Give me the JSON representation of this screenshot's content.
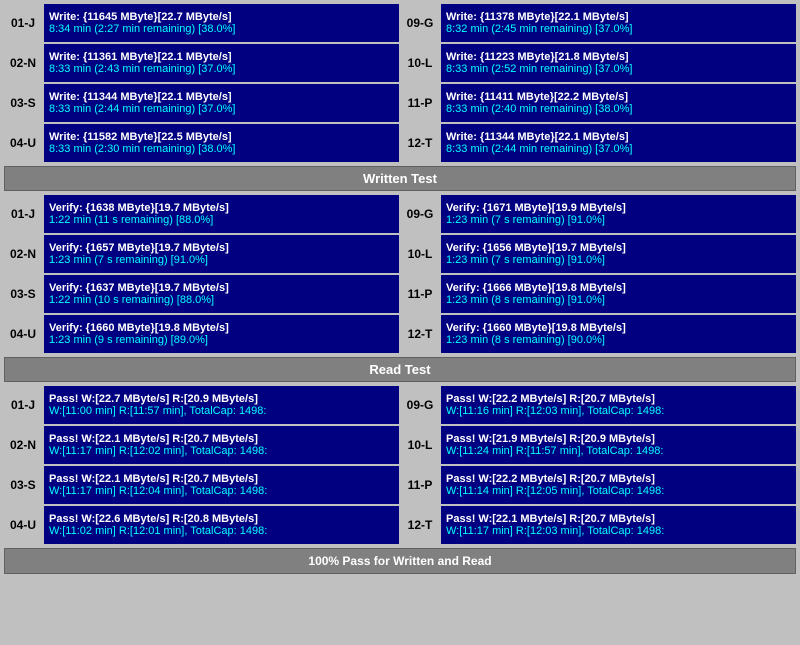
{
  "sections": {
    "write_test": {
      "label": "Written Test",
      "rows": [
        {
          "left": {
            "id": "01-J",
            "line1": "Write: {11645 MByte}[22.7 MByte/s]",
            "line2": "8:34 min (2:27 min remaining)  [38.0%]"
          },
          "right": {
            "id": "09-G",
            "line1": "Write: {11378 MByte}[22.1 MByte/s]",
            "line2": "8:32 min (2:45 min remaining)  [37.0%]"
          }
        },
        {
          "left": {
            "id": "02-N",
            "line1": "Write: {11361 MByte}[22.1 MByte/s]",
            "line2": "8:33 min (2:43 min remaining)  [37.0%]"
          },
          "right": {
            "id": "10-L",
            "line1": "Write: {11223 MByte}[21.8 MByte/s]",
            "line2": "8:33 min (2:52 min remaining)  [37.0%]"
          }
        },
        {
          "left": {
            "id": "03-S",
            "line1": "Write: {11344 MByte}[22.1 MByte/s]",
            "line2": "8:33 min (2:44 min remaining)  [37.0%]"
          },
          "right": {
            "id": "11-P",
            "line1": "Write: {11411 MByte}[22.2 MByte/s]",
            "line2": "8:33 min (2:40 min remaining)  [38.0%]"
          }
        },
        {
          "left": {
            "id": "04-U",
            "line1": "Write: {11582 MByte}[22.5 MByte/s]",
            "line2": "8:33 min (2:30 min remaining)  [38.0%]"
          },
          "right": {
            "id": "12-T",
            "line1": "Write: {11344 MByte}[22.1 MByte/s]",
            "line2": "8:33 min (2:44 min remaining)  [37.0%]"
          }
        }
      ]
    },
    "verify_test": {
      "rows": [
        {
          "left": {
            "id": "01-J",
            "line1": "Verify: {1638 MByte}[19.7 MByte/s]",
            "line2": "1:22 min (11 s remaining)  [88.0%]"
          },
          "right": {
            "id": "09-G",
            "line1": "Verify: {1671 MByte}[19.9 MByte/s]",
            "line2": "1:23 min (7 s remaining)  [91.0%]"
          }
        },
        {
          "left": {
            "id": "02-N",
            "line1": "Verify: {1657 MByte}[19.7 MByte/s]",
            "line2": "1:23 min (7 s remaining)  [91.0%]"
          },
          "right": {
            "id": "10-L",
            "line1": "Verify: {1656 MByte}[19.7 MByte/s]",
            "line2": "1:23 min (7 s remaining)  [91.0%]"
          }
        },
        {
          "left": {
            "id": "03-S",
            "line1": "Verify: {1637 MByte}[19.7 MByte/s]",
            "line2": "1:22 min (10 s remaining)  [88.0%]"
          },
          "right": {
            "id": "11-P",
            "line1": "Verify: {1666 MByte}[19.8 MByte/s]",
            "line2": "1:23 min (8 s remaining)  [91.0%]"
          }
        },
        {
          "left": {
            "id": "04-U",
            "line1": "Verify: {1660 MByte}[19.8 MByte/s]",
            "line2": "1:23 min (9 s remaining)  [89.0%]"
          },
          "right": {
            "id": "12-T",
            "line1": "Verify: {1660 MByte}[19.8 MByte/s]",
            "line2": "1:23 min (8 s remaining)  [90.0%]"
          }
        }
      ]
    },
    "read_test": {
      "label": "Read Test",
      "rows": [
        {
          "left": {
            "id": "01-J",
            "line1": "Pass! W:[22.7 MByte/s] R:[20.9 MByte/s]",
            "line2": "W:[11:00 min] R:[11:57 min], TotalCap: 1498:"
          },
          "right": {
            "id": "09-G",
            "line1": "Pass! W:[22.2 MByte/s] R:[20.7 MByte/s]",
            "line2": "W:[11:16 min] R:[12:03 min], TotalCap: 1498:"
          }
        },
        {
          "left": {
            "id": "02-N",
            "line1": "Pass! W:[22.1 MByte/s] R:[20.7 MByte/s]",
            "line2": "W:[11:17 min] R:[12:02 min], TotalCap: 1498:"
          },
          "right": {
            "id": "10-L",
            "line1": "Pass! W:[21.9 MByte/s] R:[20.9 MByte/s]",
            "line2": "W:[11:24 min] R:[11:57 min], TotalCap: 1498:"
          }
        },
        {
          "left": {
            "id": "03-S",
            "line1": "Pass! W:[22.1 MByte/s] R:[20.7 MByte/s]",
            "line2": "W:[11:17 min] R:[12:04 min], TotalCap: 1498:"
          },
          "right": {
            "id": "11-P",
            "line1": "Pass! W:[22.2 MByte/s] R:[20.7 MByte/s]",
            "line2": "W:[11:14 min] R:[12:05 min], TotalCap: 1498:"
          }
        },
        {
          "left": {
            "id": "04-U",
            "line1": "Pass! W:[22.6 MByte/s] R:[20.8 MByte/s]",
            "line2": "W:[11:02 min] R:[12:01 min], TotalCap: 1498:"
          },
          "right": {
            "id": "12-T",
            "line1": "Pass! W:[22.1 MByte/s] R:[20.7 MByte/s]",
            "line2": "W:[11:17 min] R:[12:03 min], TotalCap: 1498:"
          }
        }
      ]
    }
  },
  "labels": {
    "written_test": "Written Test",
    "read_test": "Read Test",
    "footer": "100% Pass for Written and Read"
  }
}
